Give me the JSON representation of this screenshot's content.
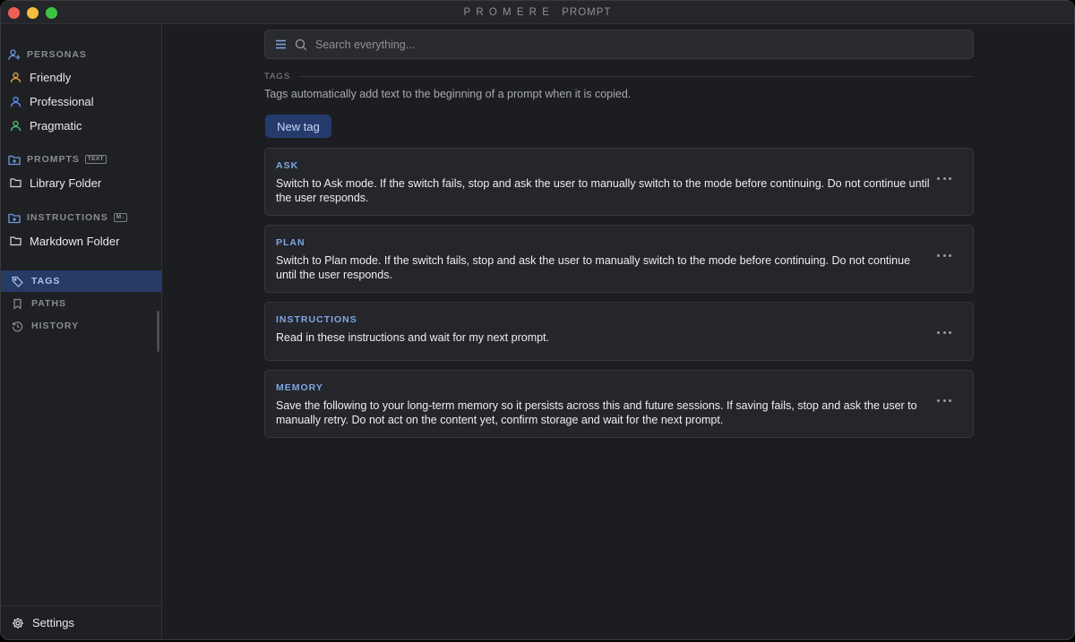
{
  "window": {
    "brand": "PROMERE",
    "title": "PROMPT"
  },
  "sidebar": {
    "personas": {
      "header": "PERSONAS",
      "items": [
        {
          "label": "Friendly",
          "icon": "person-icon",
          "color": "#f0a54a"
        },
        {
          "label": "Professional",
          "icon": "person-icon",
          "color": "#5b95f0"
        },
        {
          "label": "Pragmatic",
          "icon": "person-icon",
          "color": "#4ec76a"
        }
      ]
    },
    "prompts": {
      "header": "PROMPTS",
      "badge": "TEXT",
      "folder": "Library Folder"
    },
    "instructions": {
      "header": "INSTRUCTIONS",
      "badge": "M↓",
      "folder": "Markdown Folder"
    },
    "nav": [
      {
        "label": "TAGS",
        "icon": "tag-icon",
        "active": true
      },
      {
        "label": "PATHS",
        "icon": "bookmark-icon",
        "active": false
      },
      {
        "label": "HISTORY",
        "icon": "history-icon",
        "active": false
      }
    ],
    "settings_label": "Settings"
  },
  "search": {
    "placeholder": "Search everything..."
  },
  "tags_section": {
    "header": "TAGS",
    "description": "Tags automatically add text to the beginning of a prompt when it is copied.",
    "new_button": "New tag"
  },
  "tags": [
    {
      "name": "ASK",
      "text": "Switch to Ask mode. If the switch fails, stop and ask the user to manually switch to the mode before continuing. Do not continue until the user responds."
    },
    {
      "name": "PLAN",
      "text": "Switch to Plan mode. If the switch fails, stop and ask the user to manually switch to the mode before continuing. Do not continue until the user responds."
    },
    {
      "name": "INSTRUCTIONS",
      "text": "Read in these instructions and wait for my next prompt."
    },
    {
      "name": "MEMORY",
      "text": "Save the following to your long-term memory so it persists across this and future sessions. If saving fails, stop and ask the user to manually retry. Do not act on the content yet, confirm storage and wait for the next prompt."
    }
  ],
  "colors": {
    "accent": "#7ea6e4",
    "active_nav_bg": "#263a66",
    "button_bg": "#243b6c"
  }
}
